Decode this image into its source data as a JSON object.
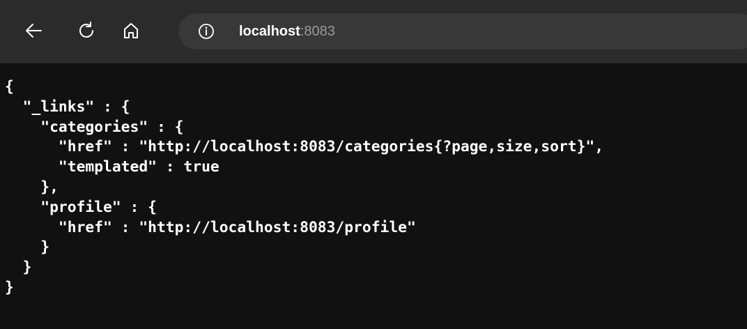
{
  "browser": {
    "url_host": "localhost",
    "url_port": ":8083",
    "icons": {
      "back": "back-arrow-icon",
      "reload": "reload-icon",
      "home": "home-icon",
      "info": "info-icon"
    }
  },
  "page": {
    "json_lines": [
      "{",
      "  \"_links\" : {",
      "    \"categories\" : {",
      "      \"href\" : \"http://localhost:8083/categories{?page,size,sort}\",",
      "      \"templated\" : true",
      "    },",
      "    \"profile\" : {",
      "      \"href\" : \"http://localhost:8083/profile\"",
      "    }",
      "  }",
      "}"
    ]
  },
  "colors": {
    "toolbar_bg": "#2b2b2b",
    "address_bg": "#383838",
    "page_bg": "#111111",
    "text": "#ffffff",
    "port_text": "#9a9a9a"
  }
}
